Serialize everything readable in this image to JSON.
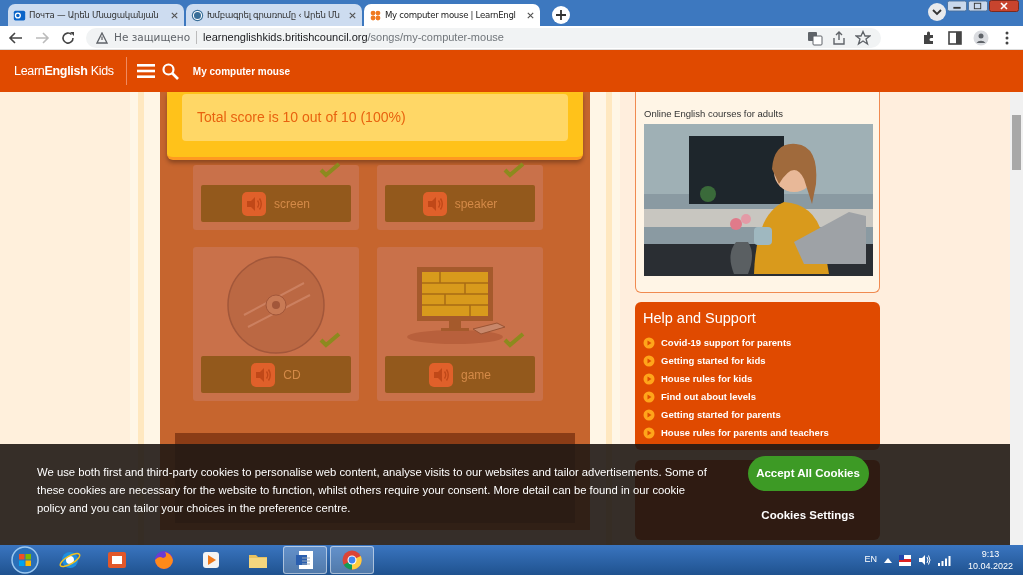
{
  "browser": {
    "tabs": [
      {
        "title": "Почта — Արեն Մնացականյան",
        "selected": false
      },
      {
        "title": "Խմբագրել գրառումը ‹ Արեն Մն",
        "selected": false
      },
      {
        "title": "My computer mouse | LearnEngl",
        "selected": true
      }
    ],
    "security": "Не защищено",
    "url_host": "learnenglishkids.britishcouncil.org",
    "url_path": "/songs/my-computer-mouse"
  },
  "site_header": {
    "logo": "Learn**English** Kids",
    "page_title": "My computer mouse"
  },
  "game": {
    "score": "Total score is 10 out of 10 (100%)",
    "cards": [
      {
        "word": "screen",
        "checked": true
      },
      {
        "word": "speaker",
        "checked": true
      },
      {
        "word": "CD",
        "checked": true
      },
      {
        "word": "game",
        "checked": true
      }
    ]
  },
  "sidebar": {
    "promo_caption": "Online English courses for adults",
    "help": {
      "title": "Help and Support",
      "items": [
        "Covid-19 support for parents",
        "Getting started for kids",
        "House rules for kids",
        "Find out about levels",
        "Getting started for parents",
        "House rules for parents and teachers"
      ]
    }
  },
  "cookie_banner": {
    "text": "We use both first and third-party cookies to personalise web content, analyse visits to our websites and tailor advertisements. Some of these cookies are necessary for the website to function, whilst others require your consent. More detail can be found in our cookie policy and you can tailor your choices in the preference centre.",
    "accept": "Accept All Cookies",
    "settings": "Cookies Settings"
  },
  "taskbar": {
    "apps": [
      {
        "kind": "ie",
        "running": false
      },
      {
        "kind": "slides",
        "running": false
      },
      {
        "kind": "firefox",
        "running": false
      },
      {
        "kind": "media",
        "running": false
      },
      {
        "kind": "folder",
        "running": false
      },
      {
        "kind": "word",
        "running": true
      },
      {
        "kind": "chrome",
        "running": true
      }
    ],
    "language": "EN",
    "time": "9:13",
    "date": "10.04.2022"
  }
}
